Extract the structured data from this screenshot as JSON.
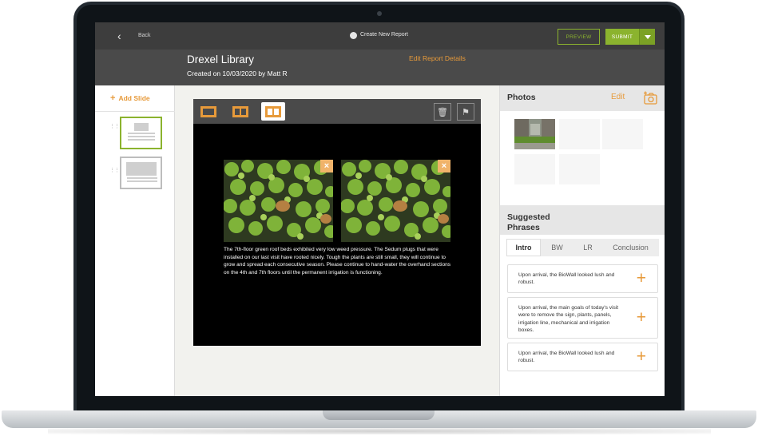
{
  "topbar": {
    "back_label": "Back",
    "create_label": "Create New Report",
    "preview_label": "PREVIEW",
    "submit_label": "SUBMIT"
  },
  "header": {
    "title": "Drexel Library",
    "subtitle": "Created on 10/03/2020 by Matt R",
    "edit_label": "Edit Report Details"
  },
  "slides": {
    "add_label": "Add Slide",
    "items": [
      {
        "active": true
      },
      {
        "active": false
      }
    ]
  },
  "editor": {
    "caption": "The 7th-floor green roof beds exhibited very low weed pressure. The Sedum plugs that were installed on our last visit have rooted nicely. Tough the plants are still small, they will continue to grow and spread each consecutive season. Please continue to hand-water the overhand sections on the 4th and 7th floors until the permanent irrigation is functioning."
  },
  "photos": {
    "title": "Photos",
    "edit_label": "Edit"
  },
  "suggested": {
    "title": "Suggested Phrases",
    "tabs": [
      "Intro",
      "BW",
      "LR",
      "Conclusion"
    ],
    "active_tab": "Intro",
    "phrases": [
      "Upon arrival, the BioWall looked lush and robust.",
      "Upon arrival, the main goals of today's visit were to remove the sign, plants, panels, irrigation line, mechanical and irrigation boxes.",
      "Upon arrival, the BioWall looked lush and robust."
    ]
  },
  "colors": {
    "accent_orange": "#e79a3a",
    "accent_green": "#8bb32e",
    "topbar": "#3d3d3d",
    "header": "#4a4a4a"
  }
}
